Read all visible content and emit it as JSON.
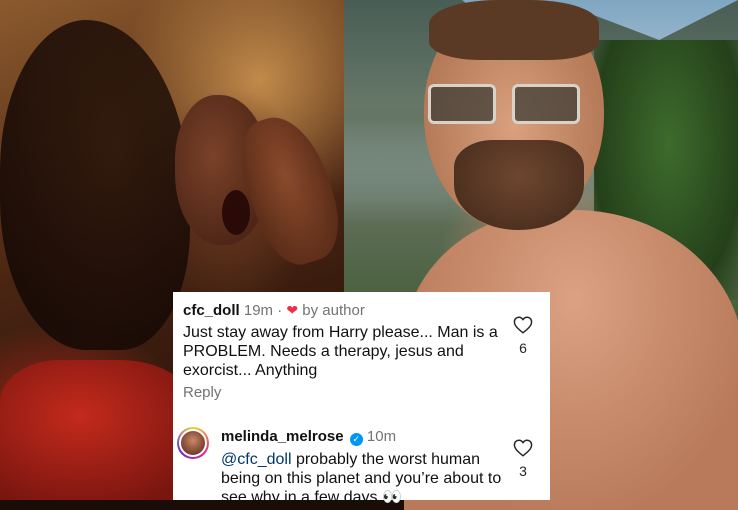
{
  "comments": [
    {
      "username": "cfc_doll",
      "time": "19m",
      "separator": "·",
      "liked_by_author_label": "by author",
      "text": "Just stay away from Harry please... Man is a PROBLEM. Needs a therapy, jesus and exorcist... Anything",
      "reply_label": "Reply",
      "likes": "6",
      "icon": "heart-outline-icon"
    },
    {
      "username": "melinda_melrose",
      "time": "10m",
      "verified": true,
      "mention": "@cfc_doll",
      "text": " probably the worst human being on this planet and you’re about to see why in a few days 👀",
      "likes": "3",
      "icon": "heart-outline-icon"
    }
  ],
  "colors": {
    "heart_red": "#ed2f45",
    "verified_blue": "#0095f6",
    "meta_gray": "#737373",
    "mention_blue": "#00376b"
  }
}
